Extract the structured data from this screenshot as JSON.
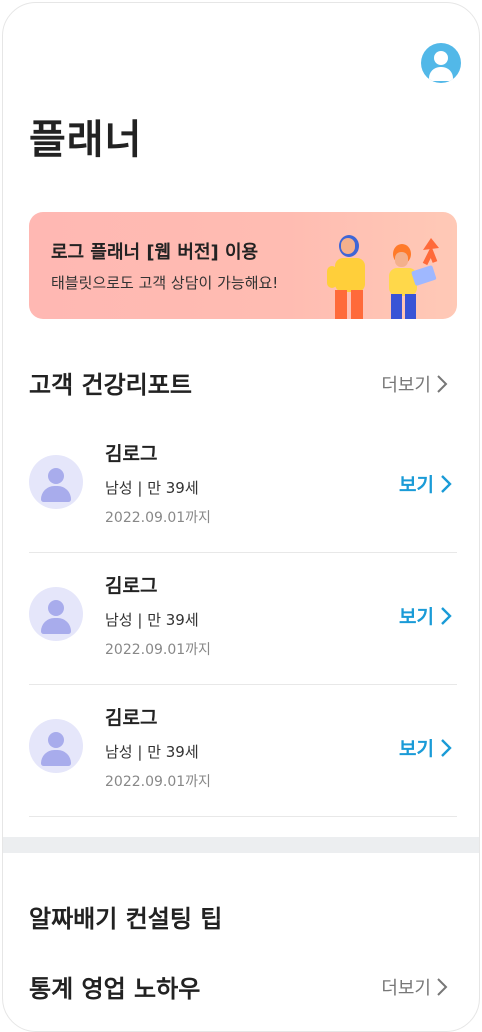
{
  "page": {
    "title": "플래너"
  },
  "header": {
    "avatar_icon": "user-icon",
    "avatar_color": "#52b8e8"
  },
  "banner": {
    "title": "로그 플래너 [웹 버전] 이용",
    "description": "태블릿으로도 고객 상담이 가능해요!",
    "illustration": "people-with-laptop-illustration",
    "background": "#ffb8b3"
  },
  "health_reports": {
    "heading": "고객 건강리포트",
    "more_label": "더보기",
    "view_label": "보기",
    "accent_color": "#1a9bd7",
    "items": [
      {
        "name": "김로그",
        "info": "남성 | 만 39세",
        "date": "2022.09.01까지"
      },
      {
        "name": "김로그",
        "info": "남성 | 만 39세",
        "date": "2022.09.01까지"
      },
      {
        "name": "김로그",
        "info": "남성 | 만 39세",
        "date": "2022.09.01까지"
      }
    ]
  },
  "tips": {
    "heading": "알짜배기 컨설팅 팁"
  },
  "sales": {
    "heading": "통계 영업 노하우",
    "more_label": "더보기"
  }
}
